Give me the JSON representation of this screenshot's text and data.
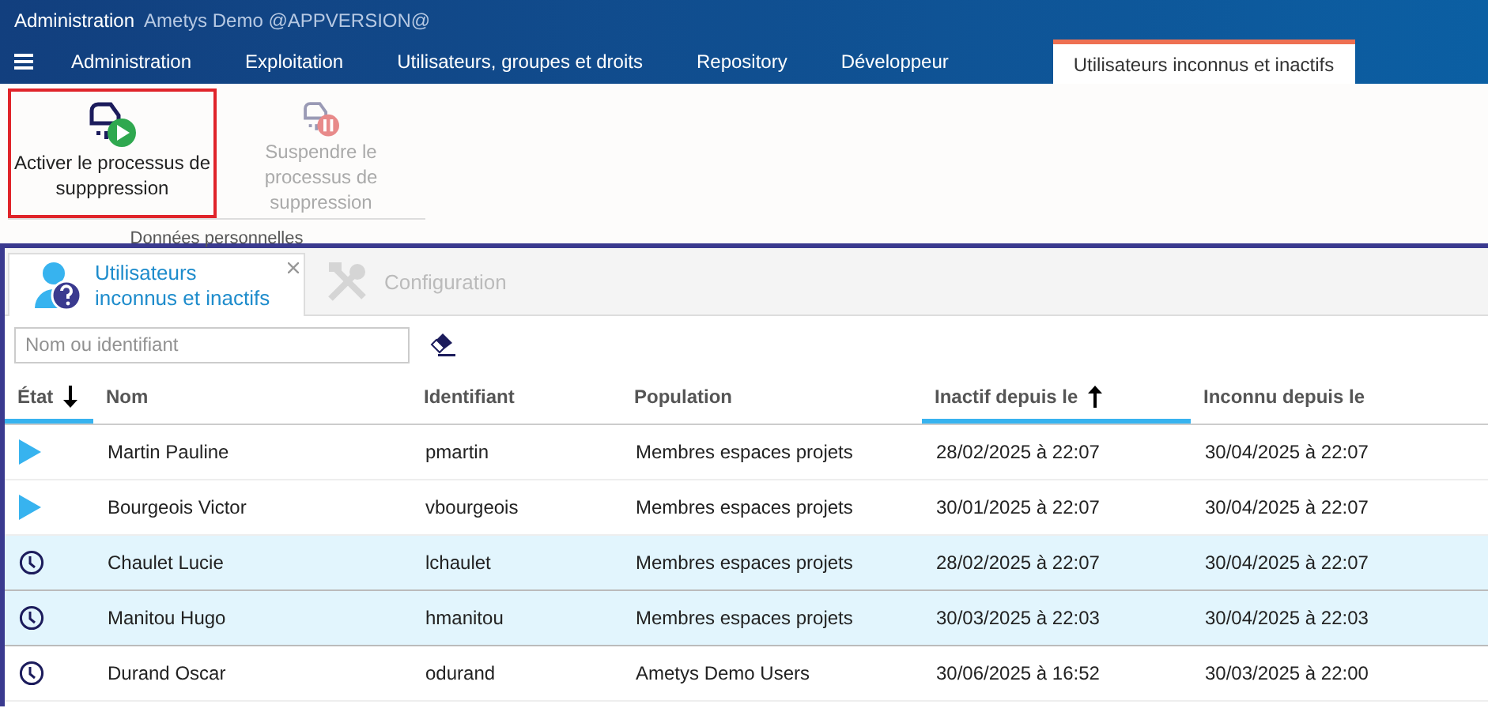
{
  "window": {
    "title": "Administration",
    "subtitle": "Ametys Demo @APPVERSION@"
  },
  "menu_tabs": [
    {
      "label": "Administration",
      "selected": false
    },
    {
      "label": "Exploitation",
      "selected": false
    },
    {
      "label": "Utilisateurs, groupes et droits",
      "selected": false
    },
    {
      "label": "Repository",
      "selected": false
    },
    {
      "label": "Développeur",
      "selected": false
    }
  ],
  "contextual_tab": {
    "label": "Utilisateurs inconnus et inactifs",
    "selected": true
  },
  "ribbon": {
    "group": "Données personnelles",
    "buttons": [
      {
        "label": "Activer le processus de supppression",
        "kind": "play",
        "disabled": false,
        "highlighted": true
      },
      {
        "label": "Suspendre le processus de suppression",
        "kind": "pause",
        "disabled": true,
        "highlighted": false
      }
    ]
  },
  "panel_tabs": [
    {
      "label": "Utilisateurs inconnus et inactifs",
      "kind": "users",
      "selected": true,
      "closable": true
    },
    {
      "label": "Configuration",
      "kind": "tools",
      "selected": false,
      "closable": false
    }
  ],
  "search": {
    "placeholder": "Nom ou identifiant"
  },
  "table": {
    "columns": [
      {
        "label": "État",
        "sorted_descending": true,
        "sorted_ascending": false
      },
      {
        "label": "Nom",
        "sorted_descending": false,
        "sorted_ascending": false
      },
      {
        "label": "Identifiant",
        "sorted_descending": false,
        "sorted_ascending": false
      },
      {
        "label": "Population",
        "sorted_descending": false,
        "sorted_ascending": false
      },
      {
        "label": "Inactif depuis le",
        "sorted_descending": false,
        "sorted_ascending": true
      },
      {
        "label": "Inconnu depuis le",
        "sorted_descending": false,
        "sorted_ascending": false
      }
    ],
    "rows": [
      {
        "kind": "running",
        "selected": false,
        "cells": [
          "",
          "Martin Pauline",
          "pmartin",
          "Membres espaces projets",
          "28/02/2025 à 22:07",
          "30/04/2025 à 22:07"
        ]
      },
      {
        "kind": "running",
        "selected": false,
        "cells": [
          "",
          "Bourgeois Victor",
          "vbourgeois",
          "Membres espaces projets",
          "30/01/2025 à 22:07",
          "30/04/2025 à 22:07"
        ]
      },
      {
        "kind": "waiting",
        "selected": true,
        "cells": [
          "",
          "Chaulet Lucie",
          "lchaulet",
          "Membres espaces projets",
          "28/02/2025 à 22:07",
          "30/04/2025 à 22:07"
        ]
      },
      {
        "kind": "waiting",
        "selected": true,
        "cells": [
          "",
          "Manitou Hugo",
          "hmanitou",
          "Membres espaces projets",
          "30/03/2025 à 22:03",
          "30/04/2025 à 22:03"
        ]
      },
      {
        "kind": "waiting",
        "selected": false,
        "cells": [
          "",
          "Durand Oscar",
          "odurand",
          "Ametys Demo Users",
          "30/06/2025 à 16:52",
          "30/03/2025 à 22:00"
        ]
      }
    ]
  }
}
